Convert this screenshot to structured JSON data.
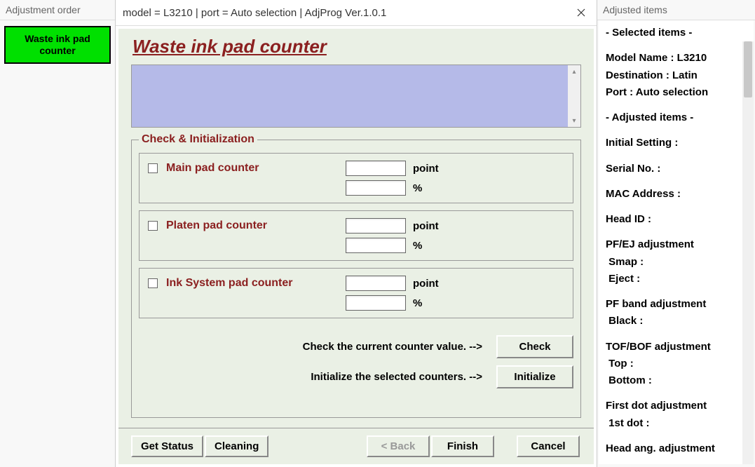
{
  "leftPanel": {
    "title": "Adjustment order",
    "button": "Waste ink pad counter"
  },
  "dialog": {
    "title": "model = L3210 | port = Auto selection | AdjProg Ver.1.0.1",
    "heading": "Waste ink pad counter",
    "fieldset": "Check & Initialization",
    "counters": [
      {
        "label": "Main pad counter",
        "point": "",
        "pct": ""
      },
      {
        "label": "Platen pad counter",
        "point": "",
        "pct": ""
      },
      {
        "label": "Ink System pad counter",
        "point": "",
        "pct": ""
      }
    ],
    "unitPoint": "point",
    "unitPct": "%",
    "checkText": "Check the current counter value. -->",
    "initText": "Initialize the selected counters. -->",
    "checkBtn": "Check",
    "initBtn": "Initialize",
    "bottom": {
      "getStatus": "Get Status",
      "cleaning": "Cleaning",
      "back": "< Back",
      "finish": "Finish",
      "cancel": "Cancel"
    }
  },
  "rightPanel": {
    "title": "Adjusted items",
    "lines": {
      "selectedHeader": "- Selected items -",
      "model": "Model Name : L3210",
      "dest": "Destination : Latin",
      "port": "Port : Auto selection",
      "adjustedHeader": "- Adjusted items -",
      "initial": "Initial Setting :",
      "serial": "Serial No. :",
      "mac": "MAC Address :",
      "headId": "Head ID :",
      "pfej": "PF/EJ adjustment",
      "smap": " Smap :",
      "eject": " Eject :",
      "pfband": "PF band adjustment",
      "black": " Black :",
      "tofbof": "TOF/BOF adjustment",
      "top": " Top :",
      "bottom": " Bottom :",
      "firstdot": "First dot adjustment",
      "dot1": " 1st dot :",
      "headang": "Head ang. adjustment"
    }
  }
}
